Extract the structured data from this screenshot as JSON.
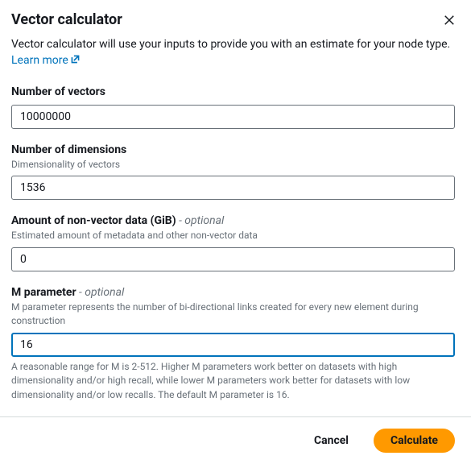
{
  "header": {
    "title": "Vector calculator"
  },
  "description": {
    "text": "Vector calculator will use your inputs to provide you with an estimate for your node type. ",
    "learn_more": "Learn more"
  },
  "fields": {
    "vectors": {
      "label": "Number of vectors",
      "value": "10000000"
    },
    "dimensions": {
      "label": "Number of dimensions",
      "hint": "Dimensionality of vectors",
      "value": "1536"
    },
    "nonvector": {
      "label": "Amount of non-vector data (GiB)",
      "optional": " - optional",
      "hint": "Estimated amount of metadata and other non-vector data",
      "value": "0"
    },
    "mparam": {
      "label": "M parameter",
      "optional": " - optional",
      "hint": "M parameter represents the number of bi-directional links created for every new element during construction",
      "value": "16",
      "help": "A reasonable range for M is 2-512. Higher M parameters work better on datasets with high dimensionality and/or high recall, while lower M parameters work better for datasets with low dimensionality and/or low recalls. The default M parameter is 16."
    }
  },
  "footer": {
    "cancel": "Cancel",
    "calculate": "Calculate"
  }
}
